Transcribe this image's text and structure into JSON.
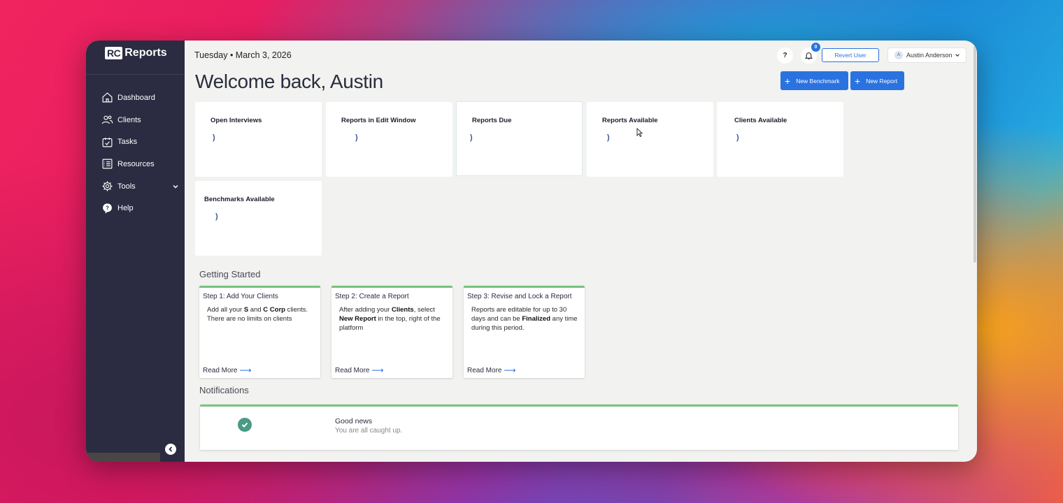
{
  "sidebar": {
    "logo_mark": "RC",
    "logo_text": "Reports",
    "items": [
      {
        "label": "Dashboard",
        "icon": "home-icon"
      },
      {
        "label": "Clients",
        "icon": "users-icon"
      },
      {
        "label": "Tasks",
        "icon": "calendar-check-icon"
      },
      {
        "label": "Resources",
        "icon": "list-icon"
      },
      {
        "label": "Tools",
        "icon": "gear-icon"
      },
      {
        "label": "Help",
        "icon": "help-bubble-icon"
      }
    ]
  },
  "header": {
    "date": "Tuesday • March 3, 2026",
    "welcome": "Welcome back, Austin",
    "help_label": "?",
    "notification_count": "0",
    "revert_user_label": "Revert User",
    "user_initial": "A",
    "user_name": "Austin Anderson",
    "new_benchmark_label": "New Benchmark",
    "new_report_label": "New Report"
  },
  "stats": [
    {
      "title": "Open Interviews"
    },
    {
      "title": "Reports in Edit Window"
    },
    {
      "title": "Reports Due"
    },
    {
      "title": "Reports Available"
    },
    {
      "title": "Clients Available"
    },
    {
      "title": "Benchmarks Available"
    }
  ],
  "loading_glyph": ")",
  "getting_started": {
    "title": "Getting Started",
    "read_more": "Read More",
    "steps": [
      {
        "title": "Step 1: Add Your Clients",
        "t1": "Add all your ",
        "b1": "S",
        "t2": " and ",
        "b2": "C Corp",
        "t3": " clients. There are no limits on clients"
      },
      {
        "title": "Step 2: Create a Report",
        "t1": "After adding your ",
        "b1": "Clients",
        "t2": ", select ",
        "b2": "New Report",
        "t3": " in the top, right of the platform"
      },
      {
        "title": "Step 3: Revise and Lock a Report",
        "t1": "Reports are editable for up to 30 days and can be ",
        "b1": "Finalized",
        "t2": " any time during this period.",
        "b2": "",
        "t3": ""
      }
    ]
  },
  "notifications": {
    "title": "Notifications",
    "item_title": "Good news",
    "item_subtitle": "You are all caught up."
  },
  "colors": {
    "sidebar_bg": "#2b2b42",
    "accent": "#2a72e0",
    "success": "#79c27e"
  }
}
